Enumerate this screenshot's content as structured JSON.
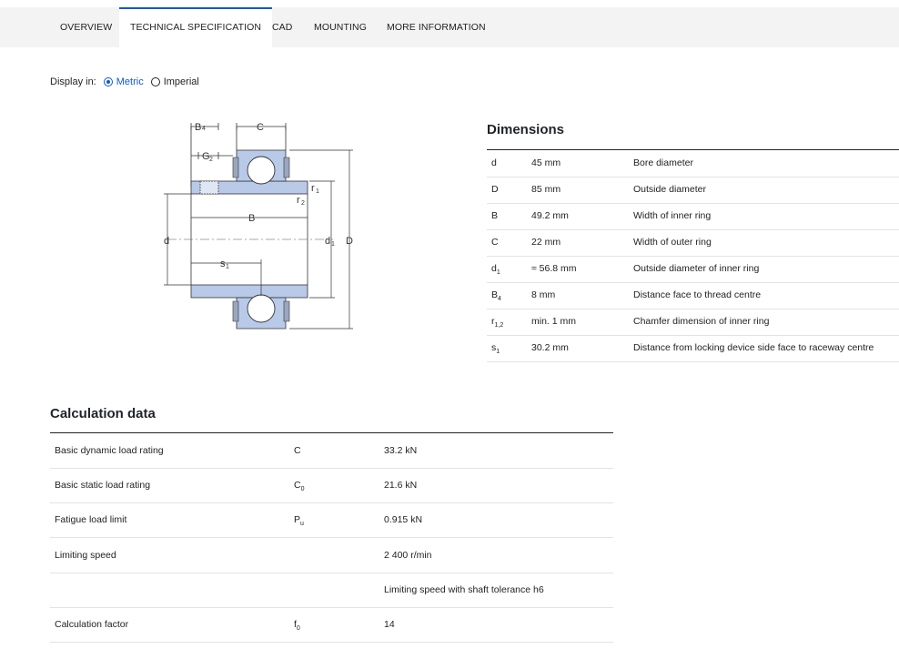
{
  "tabs": [
    {
      "label": "OVERVIEW",
      "active": false
    },
    {
      "label": "TECHNICAL SPECIFICATION",
      "active": true
    },
    {
      "label": "CAD",
      "active": false
    },
    {
      "label": "MOUNTING",
      "active": false
    },
    {
      "label": "MORE INFORMATION",
      "active": false
    }
  ],
  "display": {
    "label": "Display in:",
    "metric": "Metric",
    "imperial": "Imperial",
    "selected": "Metric"
  },
  "diagram_labels": {
    "B4": "B",
    "B4_sub": "4",
    "C": "C",
    "G2": "G",
    "G2_sub": "2",
    "r1": "r",
    "r1_sub": "1",
    "r2": "r",
    "r2_sub": "2",
    "B": "B",
    "d": "d",
    "d1": "d",
    "d1_sub": "1",
    "D": "D",
    "s1": "s",
    "s1_sub": "1"
  },
  "dimensions": {
    "title": "Dimensions",
    "rows": [
      {
        "sym": "d",
        "sub": "",
        "value": "45 mm",
        "desc": "Bore diameter"
      },
      {
        "sym": "D",
        "sub": "",
        "value": "85 mm",
        "desc": "Outside diameter"
      },
      {
        "sym": "B",
        "sub": "",
        "value": "49.2 mm",
        "desc": "Width of inner ring"
      },
      {
        "sym": "C",
        "sub": "",
        "value": "22 mm",
        "desc": "Width of outer ring"
      },
      {
        "sym": "d",
        "sub": "1",
        "value": "≈ 56.8 mm",
        "desc": "Outside diameter of inner ring"
      },
      {
        "sym": "B",
        "sub": "4",
        "value": "8 mm",
        "desc": "Distance face to thread centre"
      },
      {
        "sym": "r",
        "sub": "1,2",
        "value": "min. 1 mm",
        "desc": "Chamfer dimension of inner ring"
      },
      {
        "sym": "s",
        "sub": "1",
        "value": "30.2 mm",
        "desc": "Distance from locking device side face to raceway centre"
      }
    ]
  },
  "calculation": {
    "title": "Calculation data",
    "rows": [
      {
        "label": "Basic dynamic load rating",
        "sym": "C",
        "sub": "",
        "value": "33.2 kN"
      },
      {
        "label": "Basic static load rating",
        "sym": "C",
        "sub": "0",
        "value": "21.6 kN"
      },
      {
        "label": "Fatigue load limit",
        "sym": "P",
        "sub": "u",
        "value": "0.915 kN"
      },
      {
        "label": "Limiting speed",
        "sym": "",
        "sub": "",
        "value": "2 400 r/min"
      },
      {
        "label": "",
        "sym": "",
        "sub": "",
        "value": "Limiting speed with shaft tolerance h6"
      },
      {
        "label": "Calculation factor",
        "sym": "f",
        "sub": "0",
        "value": "14"
      }
    ]
  },
  "colors": {
    "accent": "#0f58d6",
    "diagram_fill": "#b9c9e8",
    "tabbar": "#f3f3f3"
  }
}
